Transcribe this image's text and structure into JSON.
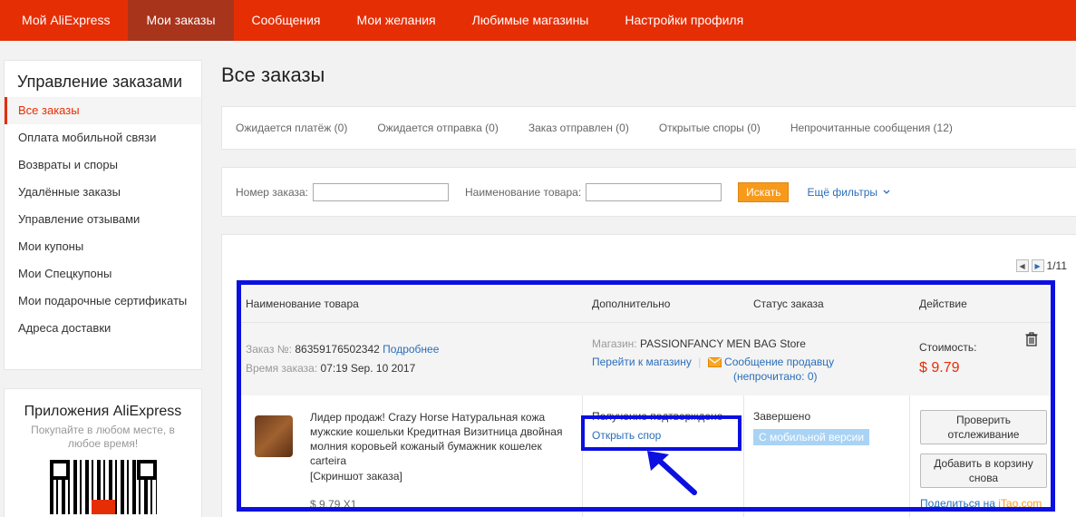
{
  "nav": {
    "items": [
      "Мой AliExpress",
      "Мои заказы",
      "Сообщения",
      "Мои желания",
      "Любимые магазины",
      "Настройки профиля"
    ],
    "active_index": 1
  },
  "sidebar": {
    "title": "Управление заказами",
    "items": [
      "Все заказы",
      "Оплата мобильной связи",
      "Возвраты и споры",
      "Удалённые заказы",
      "Управление отзывами",
      "Мои купоны",
      "Мои Спецкупоны",
      "Мои подарочные сертификаты",
      "Адреса доставки"
    ],
    "active_index": 0
  },
  "apps": {
    "title": "Приложения AliExpress",
    "subtitle": "Покупайте в любом месте, в любое время!"
  },
  "main": {
    "title": "Все заказы",
    "status_tabs": [
      "Ожидается платёж (0)",
      "Ожидается отправка (0)",
      "Заказ отправлен (0)",
      "Открытые споры (0)",
      "Непрочитанные сообщения (12)"
    ]
  },
  "filters": {
    "order_number_label": "Номер заказа:",
    "product_name_label": "Наименование товара:",
    "search_button": "Искать",
    "more_filters": "Ещё фильтры"
  },
  "pager": {
    "text": "1/11"
  },
  "table": {
    "headers": [
      "Наименование товара",
      "Дополнительно",
      "Статус заказа",
      "Действие"
    ]
  },
  "order": {
    "number_label": "Заказ №:",
    "number": "86359176502342",
    "details_link": "Подробнее",
    "time_label": "Время заказа:",
    "time": "07:19 Sep. 10 2017",
    "store_label": "Магазин:",
    "store_name": "PASSIONFANCY MEN BAG Store",
    "go_to_store": "Перейти к магазину",
    "separator": "|",
    "message_seller": "Сообщение продавцу",
    "unread_prefix": "(непрочитано: ",
    "unread_count": "0",
    "unread_suffix": ")",
    "cost_label": "Стоимость:",
    "cost": "$ 9.79",
    "product_title": "Лидер продаж! Crazy Horse Натуральная кожа мужские кошельки Кредитная Визитница двойная молния коровьей кожаный бумажник кошелек carteira",
    "snapshot": "[Скриншот заказа]",
    "unit_price": "$ 9.79 X1",
    "confirm_text": "Получение подтверждено",
    "open_dispute": "Открыть спор",
    "status": "Завершено",
    "mobile_badge": "С мобильной версии",
    "track_button": "Проверить отслеживание",
    "add_to_cart_button": "Добавить в корзину снова",
    "share_prefix": "Поделиться на ",
    "share_site": "iTao.com"
  },
  "colors": {
    "brand": "#e62e04",
    "nav_active": "#a8341c",
    "link": "#2a6ebb",
    "highlight": "#0b10e0",
    "search_button": "#f79a1b"
  }
}
